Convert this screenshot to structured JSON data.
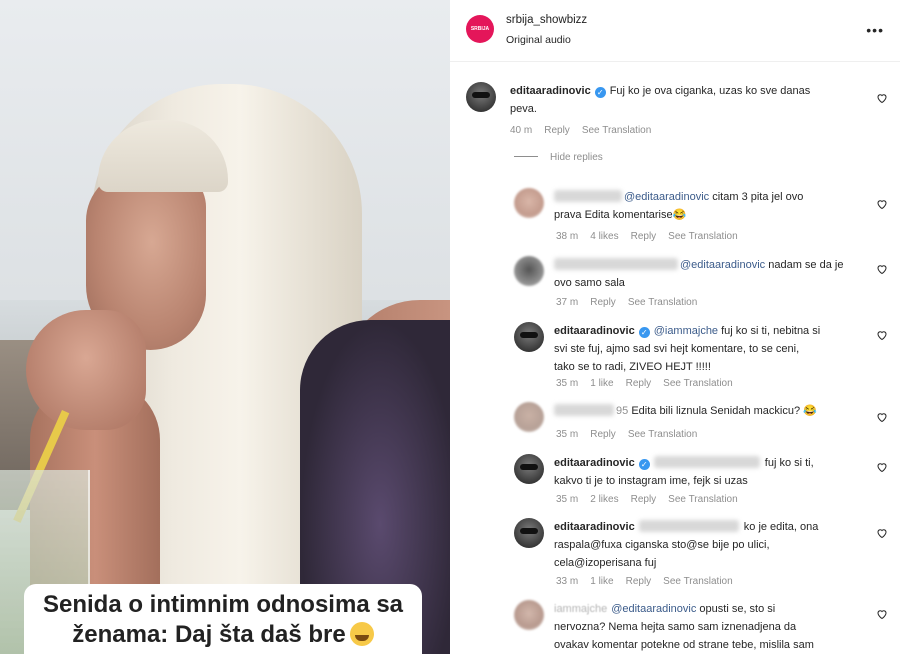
{
  "video": {
    "caption_line1": "Senida o intimnim odnosima sa",
    "caption_line2": "ženama: Daj šta daš bre",
    "caption_emoji": "sweat-smile-emoji"
  },
  "post": {
    "avatar_text": "SRBIJA SHOWBIZZ",
    "username": "srbija_showbizz",
    "subtitle": "Original audio",
    "more_icon": "more-options-icon"
  },
  "comments": [
    {
      "username": "editaaradinovic",
      "verified": true,
      "line1": "Fuj ko je ova ciganka, uzas ko sve danas",
      "line2": "peva.",
      "time": "40 m",
      "reply": "Reply",
      "translate": "See Translation"
    }
  ],
  "hide_replies": "Hide replies",
  "replies": [
    {
      "mention": "@editaaradinovic",
      "line1": "citam 3 pita jel ovo",
      "line2": "prava Edita komentarise😂",
      "time": "38 m",
      "likes": "4 likes",
      "reply": "Reply",
      "translate": "See Translation"
    },
    {
      "mention": "@editaaradinovic",
      "line1": "nadam se da je",
      "line2": "ovo samo sala",
      "time": "37 m",
      "reply": "Reply",
      "translate": "See Translation"
    },
    {
      "username": "editaaradinovic",
      "verified": true,
      "mention": "@iammajche",
      "line1": "fuj ko si ti, nebitna si",
      "line2": "svi ste fuj, ajmo sad svi hejt komentare, to se ceni,",
      "line3": "tako se to radi, ZIVEO HEJT !!!!!",
      "time": "35 m",
      "likes": "1 like",
      "reply": "Reply",
      "translate": "See Translation"
    },
    {
      "name_suffix": "95",
      "line1": "Edita bili liznula Senidah mackicu? 😂",
      "time": "35 m",
      "reply": "Reply",
      "translate": "See Translation"
    },
    {
      "username": "editaaradinovic",
      "verified": true,
      "line1": "fuj ko si ti,",
      "line2": "kakvo ti je to instagram ime, fejk si uzas",
      "time": "35 m",
      "likes": "2 likes",
      "reply": "Reply",
      "translate": "See Translation"
    },
    {
      "username": "editaaradinovic",
      "line1": "ko je edita, ona",
      "line2": "raspala@fuxa ciganska sto@se bije po ulici,",
      "line3": "cela@izoperisana fuj",
      "time": "33 m",
      "likes": "1 like",
      "reply": "Reply",
      "translate": "See Translation"
    },
    {
      "username_faded": "iammajche",
      "mention": "@editaaradinovic",
      "line1": "opusti se, sto si",
      "line2": "nervozna? Nema hejta samo sam iznenadjena da",
      "line3": "ovakav komentar potekne od strane tebe, mislila sam"
    }
  ],
  "colors": {
    "post_avatar": "#e4165a",
    "verified": "#3897f0",
    "meta_text": "#8e8e8e",
    "text": "#262626"
  }
}
